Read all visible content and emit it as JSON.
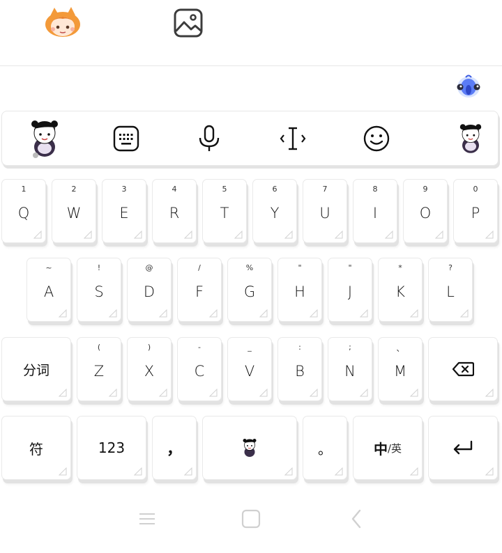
{
  "top": {
    "avatar": "chibi-avatar",
    "image_icon": "image-icon"
  },
  "toolbar": {
    "items": [
      {
        "name": "sticker-avatar-button",
        "icon": "cartoon-girl"
      },
      {
        "name": "keyboard-icon",
        "icon": "keyboard"
      },
      {
        "name": "microphone-icon",
        "icon": "microphone"
      },
      {
        "name": "cursor-move-icon",
        "icon": "text-cursor"
      },
      {
        "name": "emoji-icon",
        "icon": "smiley"
      },
      {
        "name": "skin-avatar-button",
        "icon": "cartoon-girl"
      }
    ]
  },
  "rows": {
    "row1": [
      {
        "hint": "1",
        "main": "Q"
      },
      {
        "hint": "2",
        "main": "W"
      },
      {
        "hint": "3",
        "main": "E"
      },
      {
        "hint": "4",
        "main": "R"
      },
      {
        "hint": "5",
        "main": "T"
      },
      {
        "hint": "6",
        "main": "Y"
      },
      {
        "hint": "7",
        "main": "U"
      },
      {
        "hint": "8",
        "main": "I"
      },
      {
        "hint": "9",
        "main": "O"
      },
      {
        "hint": "0",
        "main": "P"
      }
    ],
    "row2": [
      {
        "hint": "~",
        "main": "A"
      },
      {
        "hint": "!",
        "main": "S"
      },
      {
        "hint": "@",
        "main": "D"
      },
      {
        "hint": "/",
        "main": "F"
      },
      {
        "hint": "%",
        "main": "G"
      },
      {
        "hint": "\"",
        "main": "H"
      },
      {
        "hint": "\"",
        "main": "J"
      },
      {
        "hint": "*",
        "main": "K"
      },
      {
        "hint": "?",
        "main": "L"
      }
    ],
    "row3": [
      {
        "hint": "(",
        "main": "Z"
      },
      {
        "hint": ")",
        "main": "X"
      },
      {
        "hint": "-",
        "main": "C"
      },
      {
        "hint": "_",
        "main": "V"
      },
      {
        "hint": ":",
        "main": "B"
      },
      {
        "hint": ";",
        "main": "N"
      },
      {
        "hint": "、",
        "main": "M"
      }
    ]
  },
  "keys": {
    "segment": "分词",
    "symbols": "符",
    "numbers": "123",
    "comma": "，",
    "period": "。",
    "lang_primary": "中",
    "lang_secondary": "/英"
  }
}
